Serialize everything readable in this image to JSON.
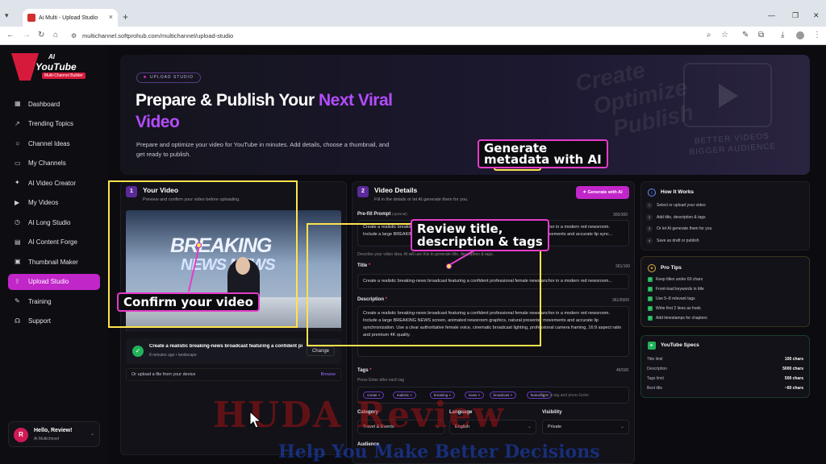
{
  "browser": {
    "tab_title": "Ai Multi - Upload Studio",
    "url": "multichannel.softprohub.com/multichannel/upload-studio"
  },
  "logo": {
    "ai": "AI",
    "brand": "YouTube",
    "sub": "Multi-Channel Builder"
  },
  "sidebar": {
    "items": [
      {
        "label": "Dashboard",
        "icon": "grid-icon"
      },
      {
        "label": "Trending Topics",
        "icon": "trend-icon"
      },
      {
        "label": "Channel Ideas",
        "icon": "lightbulb-icon"
      },
      {
        "label": "My Channels",
        "icon": "folder-icon"
      },
      {
        "label": "AI Video Creator",
        "icon": "sparkle-icon"
      },
      {
        "label": "My Videos",
        "icon": "video-icon"
      },
      {
        "label": "AI Long Studio",
        "icon": "clock-icon"
      },
      {
        "label": "AI Content Forge",
        "icon": "document-icon"
      },
      {
        "label": "Thumbnail Maker",
        "icon": "image-icon"
      },
      {
        "label": "Upload Studio",
        "icon": "upload-icon"
      },
      {
        "label": "Training",
        "icon": "graduation-icon"
      },
      {
        "label": "Support",
        "icon": "headset-icon"
      }
    ],
    "user": {
      "initial": "R",
      "name": "Hello, Review!",
      "sub": "Ai Multichnnel"
    }
  },
  "hero": {
    "pill": "UPLOAD STUDIO",
    "title_part1": "Prepare & Publish Your ",
    "title_highlight": "Next Viral",
    "title_line2": "Video",
    "description": "Prepare and optimize your video for YouTube in minutes. Add details, choose a thumbnail, and get ready to publish.",
    "bg_words": [
      "Create",
      "Optimize",
      "Publish"
    ],
    "bg_tag": [
      "BETTER VIDEOS",
      "BIGGER AUDIENCE"
    ]
  },
  "your_video": {
    "step": "1",
    "title": "Your Video",
    "subtitle": "Preview and confirm your video before uploading.",
    "thumb_line1": "BREAKING",
    "thumb_line2": "NEWS NEWS",
    "file_title": "Create a realistic breaking-news broadcast featuring a confident pr...",
    "file_meta": "8 minutes ago • landscape",
    "change_label": "Change",
    "or_upload": "Or upload a file from your device",
    "browse_label": "Browse"
  },
  "video_details": {
    "step": "2",
    "title": "Video Details",
    "subtitle": "Fill in the details or let AI generate them for you.",
    "generate_label": "Generate with AI",
    "prefill_label": "Pre-fill Prompt",
    "prefill_optional": "(optional)",
    "prefill_count": "300/300",
    "prefill_value": "Create a realistic breaking-news broadcast featuring a confident professional female news anchor in a modern red newsroom. Include a large BREAKING NEWS screen, animated newsroom graphics, natural presenter movements and accurate lip sync...",
    "prefill_hint": "Describe your video idea. AI will use this to generate title, description & tags.",
    "title_label": "Title",
    "title_count": "361/100",
    "title_value": "Create a realistic breaking-news broadcast featuring a confident professional female news anchor in a modern red newsroom...",
    "description_label": "Description",
    "description_count": "361/5000",
    "description_value": "Create a realistic breaking-news broadcast featuring a confident professional female news anchor in a modern red newsroom. Include a large BREAKING NEWS screen, animated newsroom graphics, natural presenter movements and accurate lip synchronization. Use a clear authoritative female voice, cinematic broadcast lighting, professional camera framing, 16:9 aspect ratio and premium 4K quality.",
    "tags_label": "Tags",
    "tags_count": "45/500",
    "tags_hint": "Press Enter after each tag",
    "tags": [
      "create ×",
      "realistic ×",
      "breaking ×",
      "news ×",
      "broadcast ×",
      "featuring ×"
    ],
    "tags_placeholder": "Type a tag and press Enter",
    "category_label": "Category",
    "category_value": "Travel & Events",
    "language_label": "Language",
    "language_value": "English",
    "visibility_label": "Visibility",
    "visibility_value": "Private",
    "audience_label": "Audience"
  },
  "how_it_works": {
    "title": "How It Works",
    "steps": [
      "Select or upload your video",
      "Add title, description & tags",
      "Or let AI generate them for you",
      "Save as draft or publish"
    ]
  },
  "pro_tips": {
    "title": "Pro Tips",
    "tips": [
      "Keep titles under 60 chars",
      "Front-load keywords in title",
      "Use 5–8 relevant tags",
      "Write first 2 lines as hook",
      "Add timestamps for chapters"
    ]
  },
  "youtube_specs": {
    "title": "YouTube Specs",
    "rows": [
      {
        "k": "Title limit",
        "v": "100 chars"
      },
      {
        "k": "Description",
        "v": "5000 chars"
      },
      {
        "k": "Tags limit",
        "v": "500 chars"
      },
      {
        "k": "Best title",
        "v": "~60 chars"
      }
    ]
  },
  "annotations": {
    "generate": "Generate\nmetadata with AI",
    "review": "Review title,\ndescription & tags",
    "confirm": "Confirm your video"
  },
  "watermark": {
    "line1": "HUDA Review",
    "line2": "Help You Make Better Decisions"
  },
  "colors": {
    "accent": "#c126c9",
    "purple_text": "#b44cff",
    "highlight_box": "#ffe34d",
    "callout_border": "#e43cc9"
  }
}
